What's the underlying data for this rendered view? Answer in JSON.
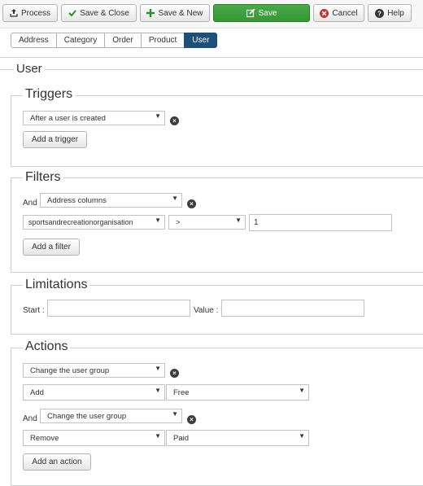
{
  "toolbar": {
    "process": "Process",
    "save_close": "Save & Close",
    "save_new": "Save & New",
    "save": "Save",
    "cancel": "Cancel",
    "help": "Help"
  },
  "tabs": [
    "Address",
    "Category",
    "Order",
    "Product",
    "User"
  ],
  "active_tab": "User",
  "section_title": "User",
  "triggers": {
    "title": "Triggers",
    "select": "After a user is created",
    "add_button": "Add a trigger"
  },
  "filters": {
    "title": "Filters",
    "and_label": "And",
    "type_select": "Address columns",
    "column_select": "sportsandrecreationorganisation",
    "operator_select": ">",
    "value": "1",
    "add_button": "Add a filter"
  },
  "limitations": {
    "title": "Limitations",
    "start_label": "Start :",
    "start_value": "",
    "value_label": "Value :",
    "value_value": ""
  },
  "actions": {
    "title": "Actions",
    "action1": {
      "select": "Change the user group",
      "mode": "Add",
      "group": "Free"
    },
    "and_label": "And",
    "action2": {
      "select": "Change the user group",
      "mode": "Remove",
      "group": "Paid"
    },
    "add_button": "Add an action"
  },
  "colors": {
    "active_tab": "#1f4e79",
    "save_button": "#3fa13f",
    "cancel_icon": "#c9302c"
  }
}
